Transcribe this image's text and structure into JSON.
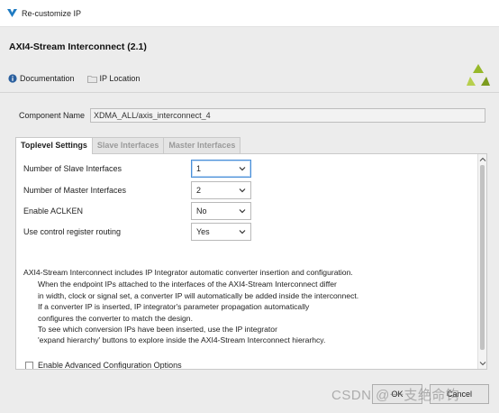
{
  "window": {
    "title": "Re-customize IP"
  },
  "header": {
    "ip_title": "AXI4-Stream Interconnect (2.1)",
    "links": [
      {
        "label": "Documentation",
        "icon": "info-icon"
      },
      {
        "label": "IP Location",
        "icon": "folder-icon"
      }
    ]
  },
  "component": {
    "label": "Component Name",
    "value": "XDMA_ALL/axis_interconnect_4"
  },
  "tabs": [
    {
      "label": "Toplevel Settings",
      "active": true
    },
    {
      "label": "Slave Interfaces",
      "active": false
    },
    {
      "label": "Master Interfaces",
      "active": false
    }
  ],
  "form": [
    {
      "label": "Number of Slave Interfaces",
      "value": "1"
    },
    {
      "label": "Number of Master Interfaces",
      "value": "2"
    },
    {
      "label": "Enable ACLKEN",
      "value": "No"
    },
    {
      "label": "Use control register routing",
      "value": "Yes"
    }
  ],
  "description": {
    "first": "AXI4-Stream Interconnect includes IP Integrator automatic converter insertion and configuration.",
    "lines": [
      "When the endpoint IPs attached to the interfaces of the AXI4-Stream Interconnect differ",
      "in width, clock or signal set, a converter IP will automatically be added inside the interconnect.",
      "If a converter IP is inserted, IP integrator's parameter propagation automatically",
      "configures the converter to match the design.",
      "To see which conversion IPs have been inserted, use the IP integrator",
      "'expand hierarchy' buttons to explore inside the AXI4-Stream Interconnect hierarhcy."
    ]
  },
  "advanced": {
    "label": "Enable Advanced Configuration Options",
    "checked": false
  },
  "buttons": {
    "ok": "OK",
    "cancel": "Cancel"
  },
  "watermark": "CSDN @一支绝命钩",
  "colors": {
    "accent_logo": "#97b82a",
    "focus_border": "#4a8fd8",
    "titlebar_icon": "#1f7bc2"
  }
}
